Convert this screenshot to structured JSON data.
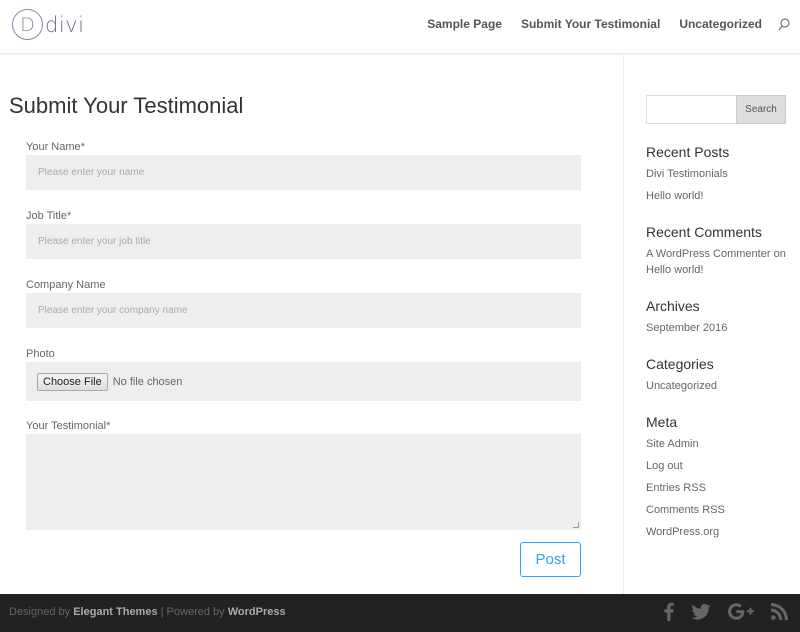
{
  "header": {
    "logo_letter": "D",
    "logo_text": "divi",
    "nav": [
      {
        "label": "Sample Page"
      },
      {
        "label": "Submit Your Testimonial"
      },
      {
        "label": "Uncategorized"
      }
    ],
    "search_icon": "search-icon"
  },
  "main": {
    "title": "Submit Your Testimonial",
    "form": {
      "name_label": "Your Name*",
      "name_placeholder": "Please enter your name",
      "job_label": "Job Title*",
      "job_placeholder": "Please enter your job title",
      "company_label": "Company Name",
      "company_placeholder": "Please enter your company name",
      "photo_label": "Photo",
      "photo_button": "Choose File",
      "photo_status": "No file chosen",
      "testimonial_label": "Your Testimonial*",
      "testimonial_value": "",
      "submit_label": "Post"
    }
  },
  "sidebar": {
    "search_button": "Search",
    "search_placeholder": "",
    "recent_posts_title": "Recent Posts",
    "recent_posts": [
      "Divi Testimonials",
      "Hello world!"
    ],
    "recent_comments_title": "Recent Comments",
    "recent_comment_author": "A WordPress Commenter",
    "recent_comment_on": "on",
    "recent_comment_post": "Hello world!",
    "archives_title": "Archives",
    "archives": [
      "September 2016"
    ],
    "categories_title": "Categories",
    "categories": [
      "Uncategorized"
    ],
    "meta_title": "Meta",
    "meta": [
      "Site Admin",
      "Log out",
      "Entries RSS",
      "Comments RSS",
      "WordPress.org"
    ]
  },
  "footer": {
    "designed_by": "Designed by",
    "theme_name": "Elegant Themes",
    "separator": "| Powered by",
    "platform": "WordPress",
    "social_icons": [
      "facebook-icon",
      "twitter-icon",
      "google-plus-icon",
      "rss-icon"
    ]
  },
  "colors": {
    "accent": "#2ea3f2",
    "logo": "#8e86b8",
    "footer_bg": "#222222",
    "field_bg": "#eeeeee"
  }
}
